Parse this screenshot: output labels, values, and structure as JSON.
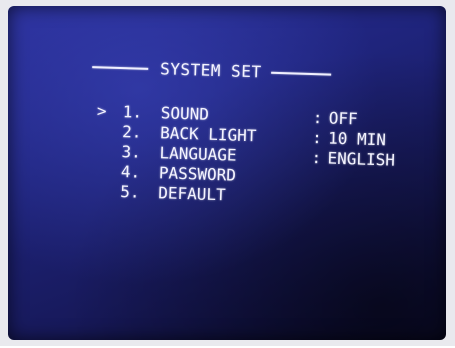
{
  "menu": {
    "title": "SYSTEM SET",
    "cursor": ">",
    "items": [
      {
        "number": "1.",
        "label": "SOUND",
        "separator": ":",
        "value": "OFF",
        "selected": true
      },
      {
        "number": "2.",
        "label": "BACK LIGHT",
        "separator": ":",
        "value": "10 MIN",
        "selected": false
      },
      {
        "number": "3.",
        "label": "LANGUAGE",
        "separator": ":",
        "value": "ENGLISH",
        "selected": false
      },
      {
        "number": "4.",
        "label": "PASSWORD",
        "separator": "",
        "value": "",
        "selected": false
      },
      {
        "number": "5.",
        "label": "DEFAULT",
        "separator": "",
        "value": "",
        "selected": false
      }
    ]
  },
  "colors": {
    "text": "#f4f4ff",
    "screen_background": "#1f247c"
  }
}
